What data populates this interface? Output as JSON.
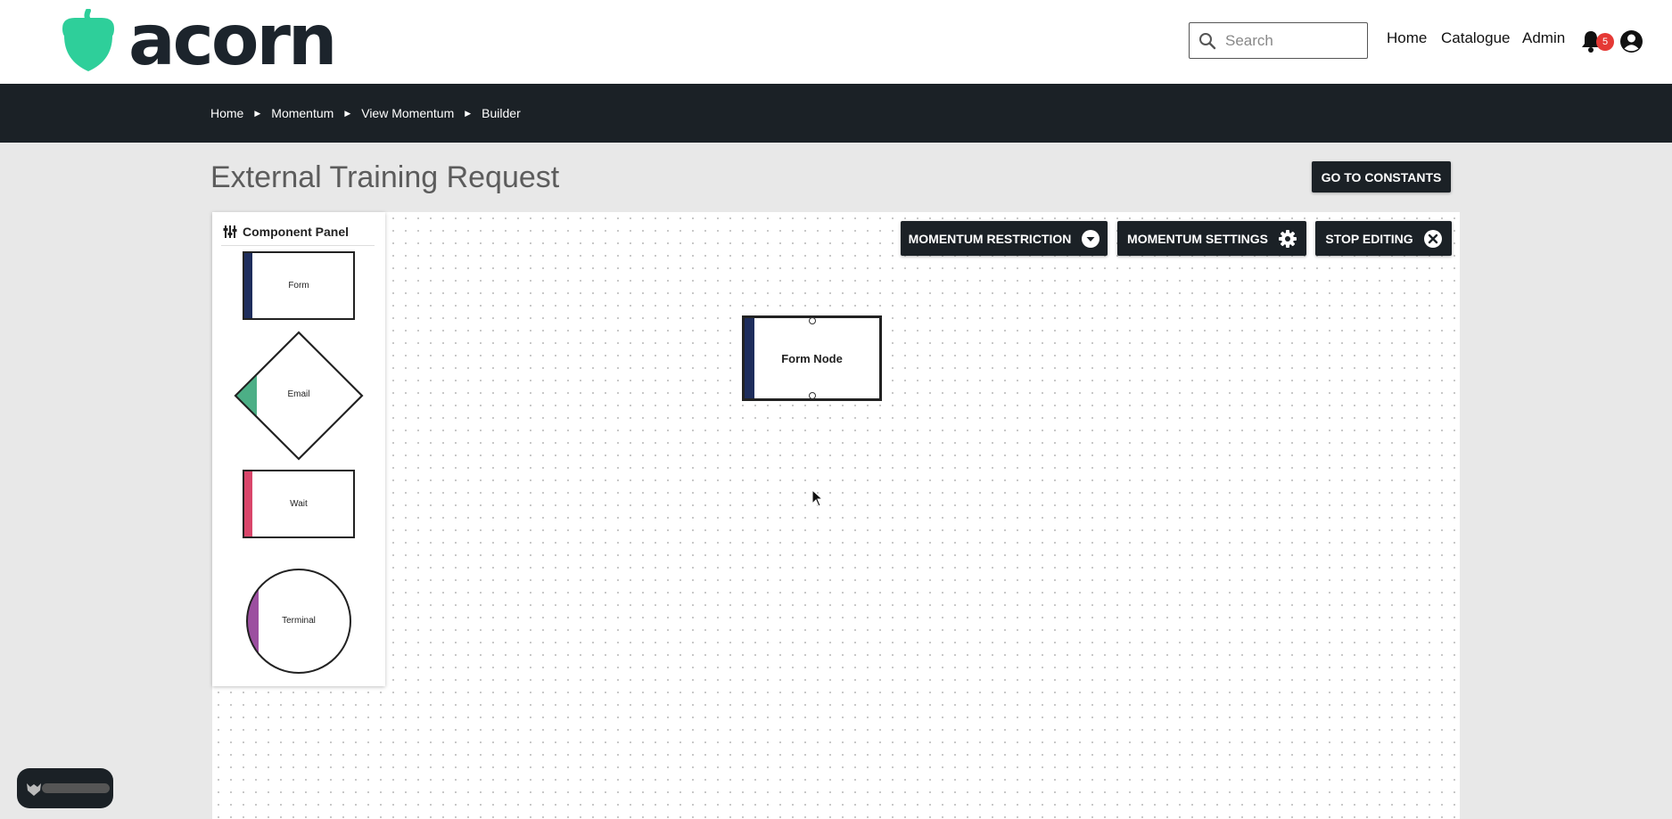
{
  "header": {
    "logo_text": "acorn",
    "search_placeholder": "Search",
    "nav": [
      "Home",
      "Catalogue",
      "Admin"
    ],
    "notification_count": "5"
  },
  "breadcrumbs": [
    "Home",
    "Momentum",
    "View Momentum",
    "Builder"
  ],
  "page": {
    "title": "External Training Request",
    "go_to_constants": "GO TO CONSTANTS"
  },
  "toolbar": {
    "restriction": "MOMENTUM RESTRICTION",
    "settings": "MOMENTUM SETTINGS",
    "stop": "STOP EDITING"
  },
  "panel": {
    "title": "Component Panel",
    "items": [
      "Form",
      "Email",
      "Wait",
      "Terminal"
    ]
  },
  "canvas": {
    "node_label": "Form Node"
  },
  "colors": {
    "brand_green": "#2ecf9a",
    "dark": "#1b2126",
    "form_accent": "#1e2d5c",
    "email_accent": "#4caf86",
    "wait_accent": "#d9456a",
    "terminal_accent": "#9c4fa0",
    "badge_red": "#e53935"
  }
}
